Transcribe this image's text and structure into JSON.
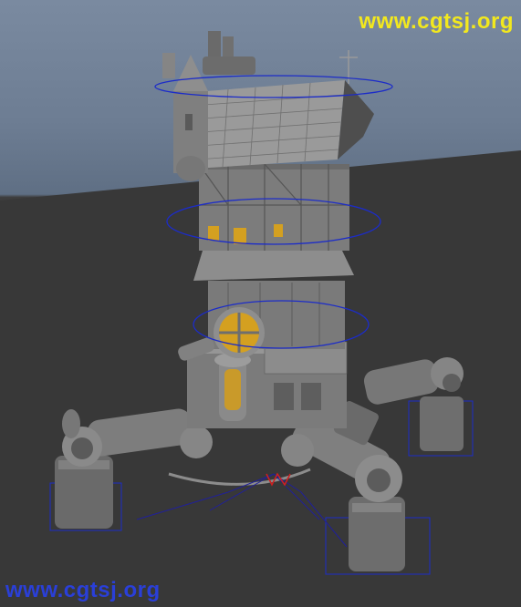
{
  "viewport": {
    "colors": {
      "sky_top": "#7a8aa0",
      "ground": "#373737",
      "model": "#8a8a8a",
      "selection_ring": "#1c2cc8",
      "glass_amber": "#d4a020",
      "pivot_red": "#d02020"
    }
  },
  "watermarks": {
    "top": "www.cgtsj.org",
    "bottom": "www.cgtsj.org"
  }
}
